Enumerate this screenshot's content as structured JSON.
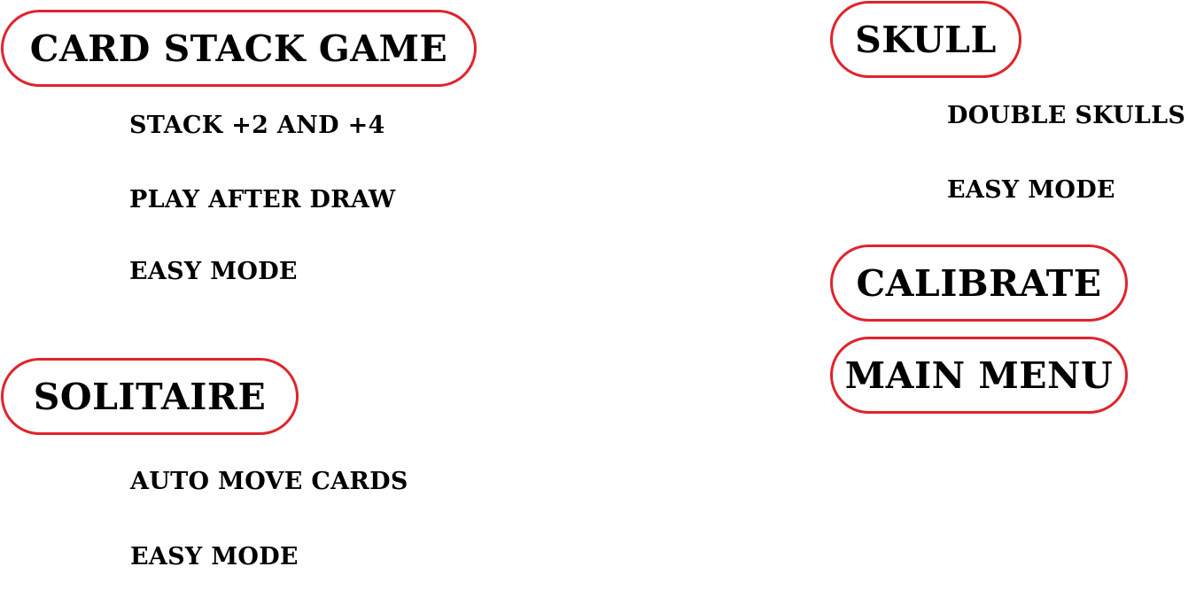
{
  "card_stack": {
    "title": "CARD STACK GAME",
    "options": [
      "STACK +2 AND +4",
      "PLAY AFTER DRAW",
      "EASY MODE"
    ]
  },
  "solitaire": {
    "title": "SOLITAIRE",
    "options": [
      "AUTO MOVE CARDS",
      "EASY MODE"
    ]
  },
  "skull": {
    "title": "SKULL",
    "options": [
      "DOUBLE SKULLS",
      "EASY MODE"
    ]
  },
  "actions": {
    "calibrate": "CALIBRATE",
    "main_menu": "MAIN MENU"
  },
  "colors": {
    "pill_border": "#e0242c",
    "text": "#000000",
    "background": "#ffffff"
  }
}
